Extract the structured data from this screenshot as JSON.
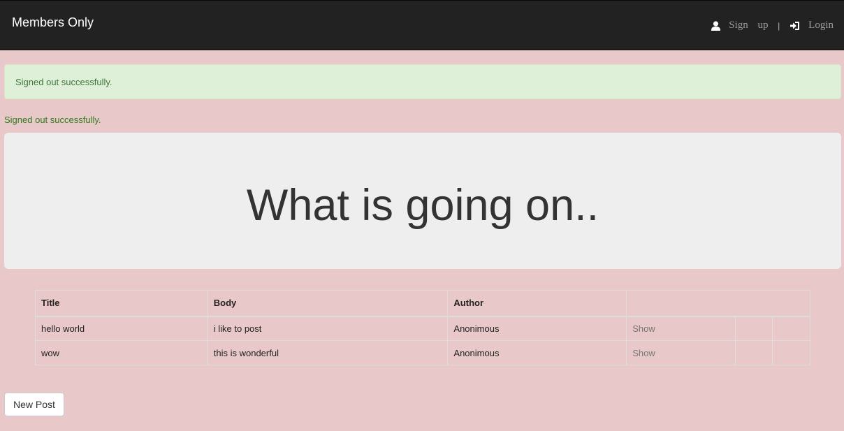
{
  "navbar": {
    "brand": "Members Only",
    "signup_label": "Sign up",
    "separator": "|",
    "login_label": "Login",
    "icons": {
      "signup": "user-icon",
      "login": "log-in-icon"
    }
  },
  "flash": {
    "message": "Signed out successfully."
  },
  "notice": {
    "message": "Signed out successfully."
  },
  "jumbotron": {
    "heading": "What is going on.."
  },
  "posts_table": {
    "headers": [
      "Title",
      "Body",
      "Author",
      ""
    ],
    "rows": [
      {
        "title": "hello world",
        "body": "i like to post",
        "author": "Anonimous",
        "action": "Show"
      },
      {
        "title": "wow",
        "body": "this is wonderful",
        "author": "Anonimous",
        "action": "Show"
      }
    ]
  },
  "new_post_button": {
    "label": "New Post"
  },
  "colors": {
    "page_bg": "#e8c8c8",
    "navbar_bg": "#222222",
    "flash_bg": "#dff0d8",
    "flash_text": "#3c763d",
    "jumbotron_bg": "#eeeeee"
  }
}
